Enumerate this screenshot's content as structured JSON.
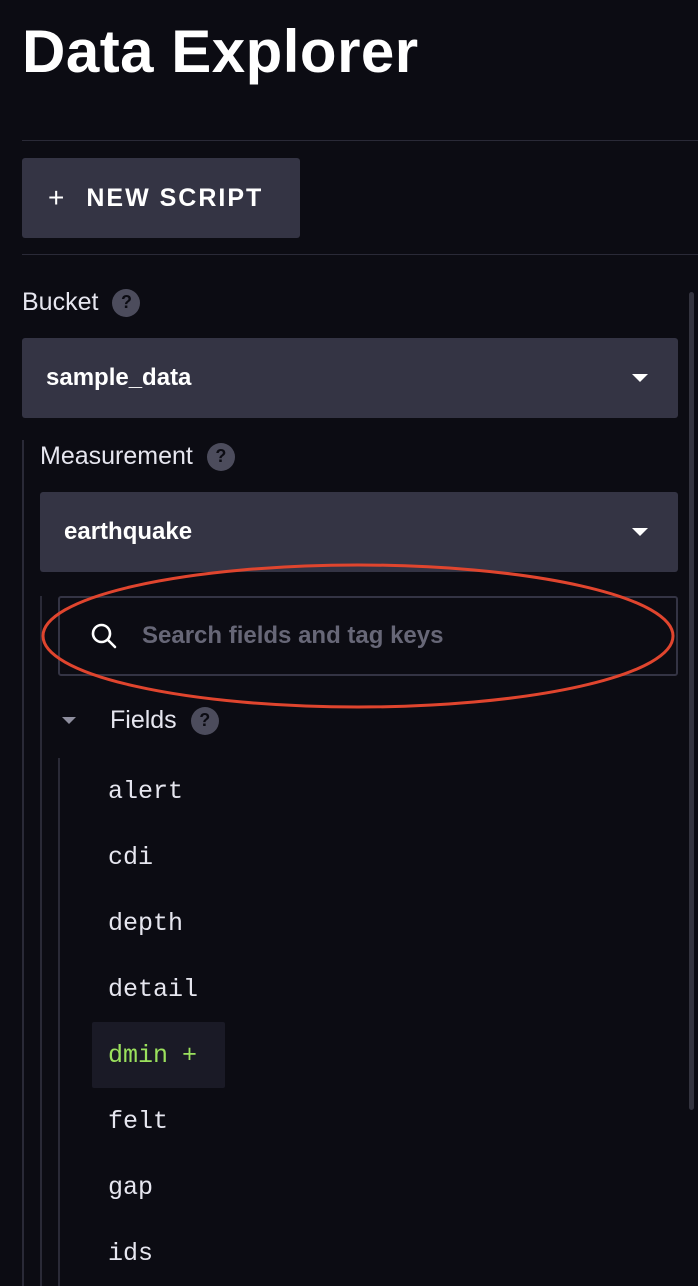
{
  "header": {
    "title": "Data Explorer"
  },
  "toolbar": {
    "new_script_icon": "+",
    "new_script_label": "NEW SCRIPT"
  },
  "bucket": {
    "label": "Bucket",
    "help_icon": "?",
    "selected": "sample_data"
  },
  "measurement": {
    "label": "Measurement",
    "help_icon": "?",
    "selected": "earthquake"
  },
  "search": {
    "placeholder": "Search fields and tag keys",
    "value": ""
  },
  "fields": {
    "label": "Fields",
    "help_icon": "?",
    "expanded": true,
    "items": [
      {
        "name": "alert"
      },
      {
        "name": "cdi"
      },
      {
        "name": "depth"
      },
      {
        "name": "detail"
      },
      {
        "name": "dmin",
        "add_symbol": "+",
        "hovered": true
      },
      {
        "name": "felt"
      },
      {
        "name": "gap"
      },
      {
        "name": "ids"
      }
    ]
  },
  "colors": {
    "background": "#0c0c13",
    "control": "#343444",
    "accent_green": "#9be15d",
    "annotation_red": "#e0452e"
  }
}
